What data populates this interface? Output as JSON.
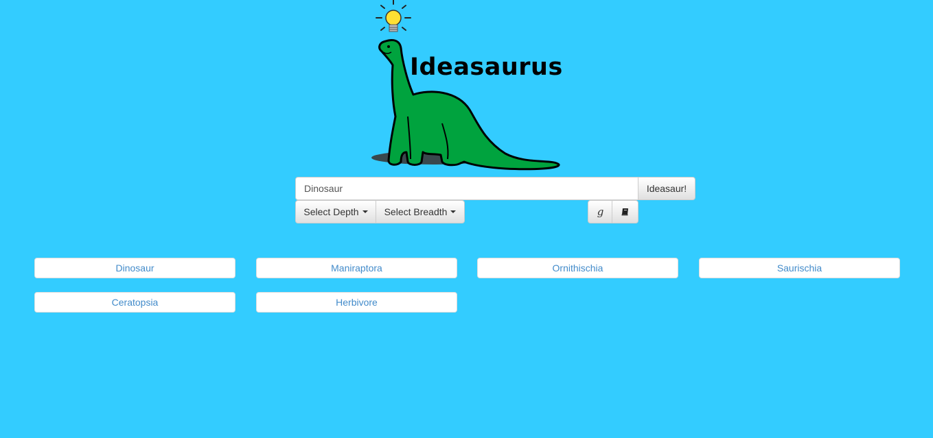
{
  "app": {
    "title": "Ideasaurus"
  },
  "search": {
    "value": "Dinosaur",
    "button_label": "Ideasaur!"
  },
  "controls": {
    "depth_label": "Select Depth",
    "breadth_label": "Select Breadth",
    "google_icon": "google-icon",
    "book_icon": "book-icon"
  },
  "results": [
    "Dinosaur",
    "Maniraptora",
    "Ornithischia",
    "Saurischia",
    "Ceratopsia",
    "Herbivore"
  ],
  "colors": {
    "background": "#33ccff",
    "dino_green": "#00a33e",
    "bulb_yellow": "#ffe033",
    "link_blue": "#428bca"
  }
}
